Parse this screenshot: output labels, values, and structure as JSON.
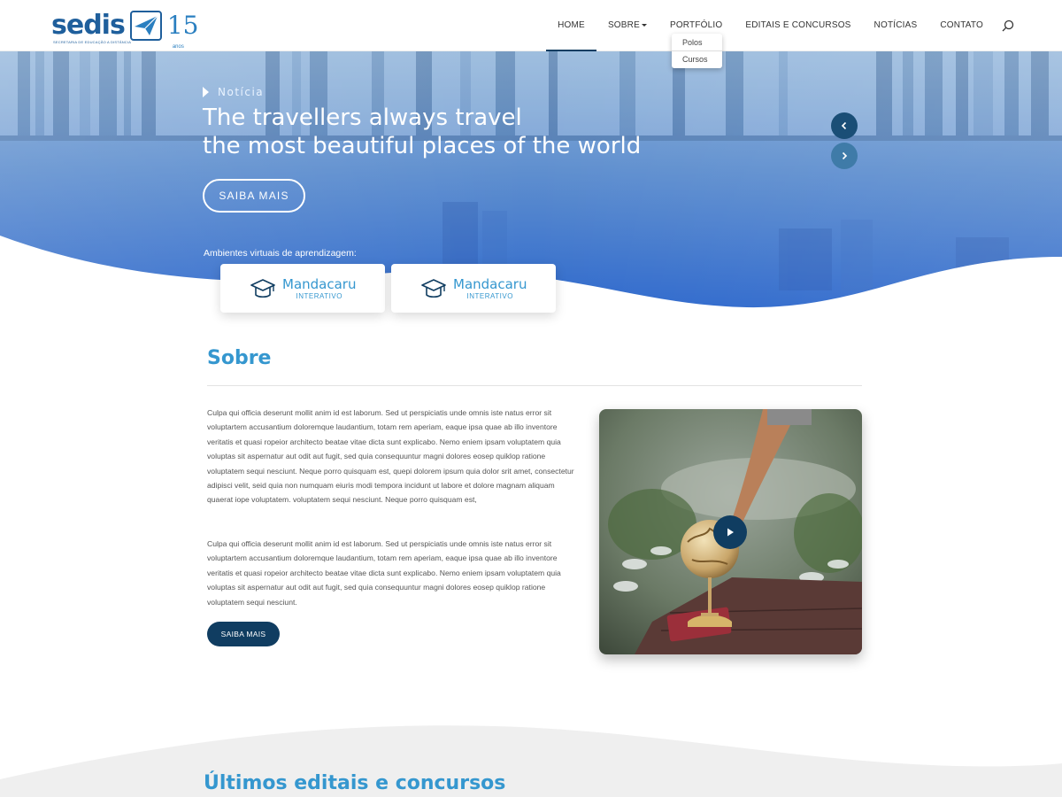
{
  "brand": {
    "name": "sedis",
    "subtitle": "SECRETARIA DE EDUCAÇÃO A DISTÂNCIA",
    "anniversary": "15",
    "anniversary_unit": "anos"
  },
  "nav": {
    "items": [
      {
        "label": "HOME",
        "active": true
      },
      {
        "label": "SOBRE",
        "has_dropdown": true
      },
      {
        "label": "PORTFÓLIO"
      },
      {
        "label": "EDITAIS E CONCURSOS"
      },
      {
        "label": "NOTÍCIAS"
      },
      {
        "label": "CONTATO"
      }
    ],
    "search_icon": "search-icon",
    "dropdown": [
      "Polos",
      "Cursos"
    ]
  },
  "hero": {
    "tag": "Notícia",
    "title_line1": "The travellers always travel",
    "title_line2": "the most beautiful places of the world",
    "button": "SAIBA MAIS",
    "ava_label": "Ambientes virtuais de aprendizagem:",
    "cards": [
      {
        "name": "Mandacaru",
        "sub": "INTERATIVO",
        "icon": "graduation-cap-icon"
      },
      {
        "name": "Mandacaru",
        "sub": "INTERATIVO",
        "icon": "graduation-cap-icon"
      }
    ]
  },
  "sobre": {
    "title": "Sobre",
    "paragraph1": "Culpa qui officia deserunt mollit anim id est laborum. Sed ut perspiciatis unde omnis iste natus error sit voluptartem accusantium doloremque laudantium, totam rem aperiam, eaque ipsa quae ab illo inventore veritatis et quasi ropeior architecto beatae vitae dicta sunt explicabo. Nemo eniem ipsam voluptatem quia voluptas sit aspernatur aut odit aut fugit, sed quia consequuntur magni dolores eosep quiklop ratione voluptatem sequi nesciunt. Neque porro quisquam est, quepi dolorem ipsum quia dolor srit amet, consectetur adipisci velit, seid quia non numquam eiuris modi tempora incidunt ut labore et dolore magnam aliquam quaerat iope voluptatem. voluptatem sequi nesciunt. Neque porro quisquam est,",
    "paragraph2": "Culpa qui officia deserunt mollit anim id est laborum. Sed ut perspiciatis unde omnis iste natus error sit voluptartem accusantium doloremque laudantium, totam rem aperiam, eaque ipsa quae ab illo inventore veritatis et quasi ropeior architecto beatae vitae dicta sunt explicabo. Nemo eniem ipsam voluptatem quia voluptas sit aspernatur aut odit aut fugit, sed quia consequuntur magni dolores eosep quiklop ratione voluptatem sequi nesciunt.",
    "button": "SAIBA MAIS"
  },
  "editais": {
    "title": "Últimos editais e concursos"
  },
  "colors": {
    "accent": "#3597cf",
    "dark": "#103d61",
    "hero_top": "#7fa9d6",
    "hero_bottom": "#2e6fd0"
  }
}
